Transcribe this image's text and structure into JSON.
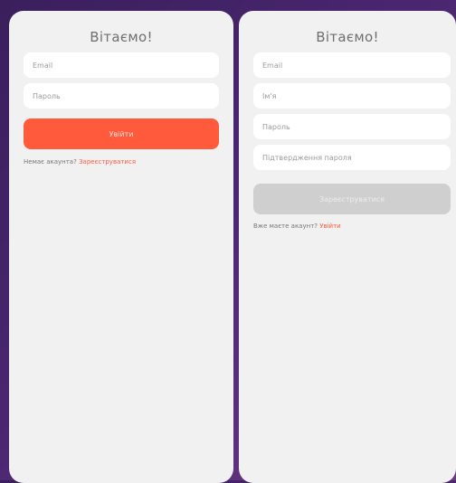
{
  "login": {
    "title": "Вітаємо!",
    "email_placeholder": "Email",
    "password_placeholder": "Пароль",
    "submit_label": "Увійти",
    "footer_text": "Немає акаунта?",
    "footer_link": "Зареєструватися"
  },
  "register": {
    "title": "Вітаємо!",
    "email_placeholder": "Email",
    "name_placeholder": "Ім'я",
    "password_placeholder": "Пароль",
    "confirm_placeholder": "Підтвердження пароля",
    "submit_label": "Зареєструватися",
    "footer_text": "Вже маєте акаунт?",
    "footer_link": "Увійти"
  },
  "colors": {
    "accent": "#ff5a3c",
    "disabled_button": "#cfcfcf",
    "panel_bg": "#f1f1f1",
    "background_gradient_start": "#3a1f5c",
    "background_gradient_end": "#6a3a84"
  }
}
